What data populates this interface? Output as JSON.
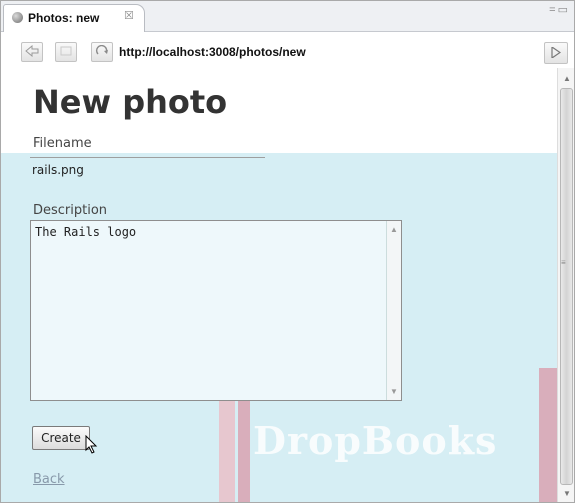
{
  "tab": {
    "title": "Photos: new",
    "close_glyph": "☒"
  },
  "window": {
    "controls": "=▭"
  },
  "nav": {
    "back_icon": "back-arrow-icon",
    "forward_icon": "forward-arrow-icon",
    "refresh_icon": "refresh-icon",
    "url": "http://localhost:3008/photos/new",
    "go_icon": "go-arrow-icon"
  },
  "page": {
    "heading": "New photo",
    "filename_label": "Filename",
    "filename_value": "rails.png",
    "description_label": "Description",
    "description_value": "The Rails logo",
    "create_label": "Create",
    "back_link": "Back"
  },
  "watermark": {
    "text": "DropBooks"
  },
  "colors": {
    "page_bg": "#d6eef4",
    "watermark_accent": "#d9aebb"
  }
}
